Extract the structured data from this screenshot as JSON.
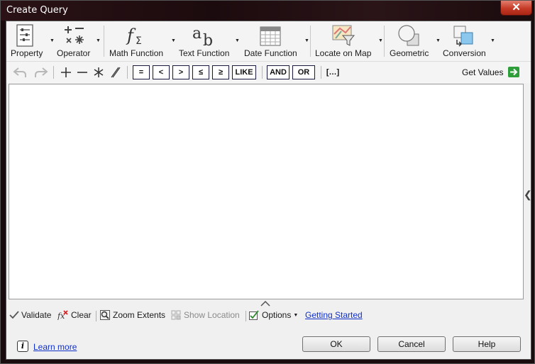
{
  "window": {
    "title": "Create Query",
    "close_glyph": "✕"
  },
  "ribbon": {
    "groups": [
      {
        "label": "Property",
        "icon": "property-list-icon"
      },
      {
        "label": "Operator",
        "icon": "operator-symbols-icon"
      },
      {
        "label": "Math Function",
        "icon": "math-function-icon"
      },
      {
        "label": "Text Function",
        "icon": "text-function-icon"
      },
      {
        "label": "Date Function",
        "icon": "calendar-icon"
      },
      {
        "label": "Locate on Map",
        "icon": "map-filter-icon"
      },
      {
        "label": "Geometric",
        "icon": "geometry-shapes-icon"
      },
      {
        "label": "Conversion",
        "icon": "conversion-icon"
      }
    ],
    "dropdown_glyph": "▼"
  },
  "toolbar": {
    "operators": [
      "=",
      "<",
      ">",
      "≤",
      "≥",
      "LIKE"
    ],
    "logical": [
      "AND",
      "OR"
    ],
    "brackets": "[…]",
    "get_values": "Get Values"
  },
  "bottom": {
    "validate": "Validate",
    "clear": "Clear",
    "zoom_extents": "Zoom Extents",
    "show_location": "Show Location",
    "options": "Options",
    "getting_started": "Getting Started"
  },
  "footer": {
    "learn_more": "Learn more",
    "info_glyph": "i",
    "ok": "OK",
    "cancel": "Cancel",
    "help": "Help"
  }
}
